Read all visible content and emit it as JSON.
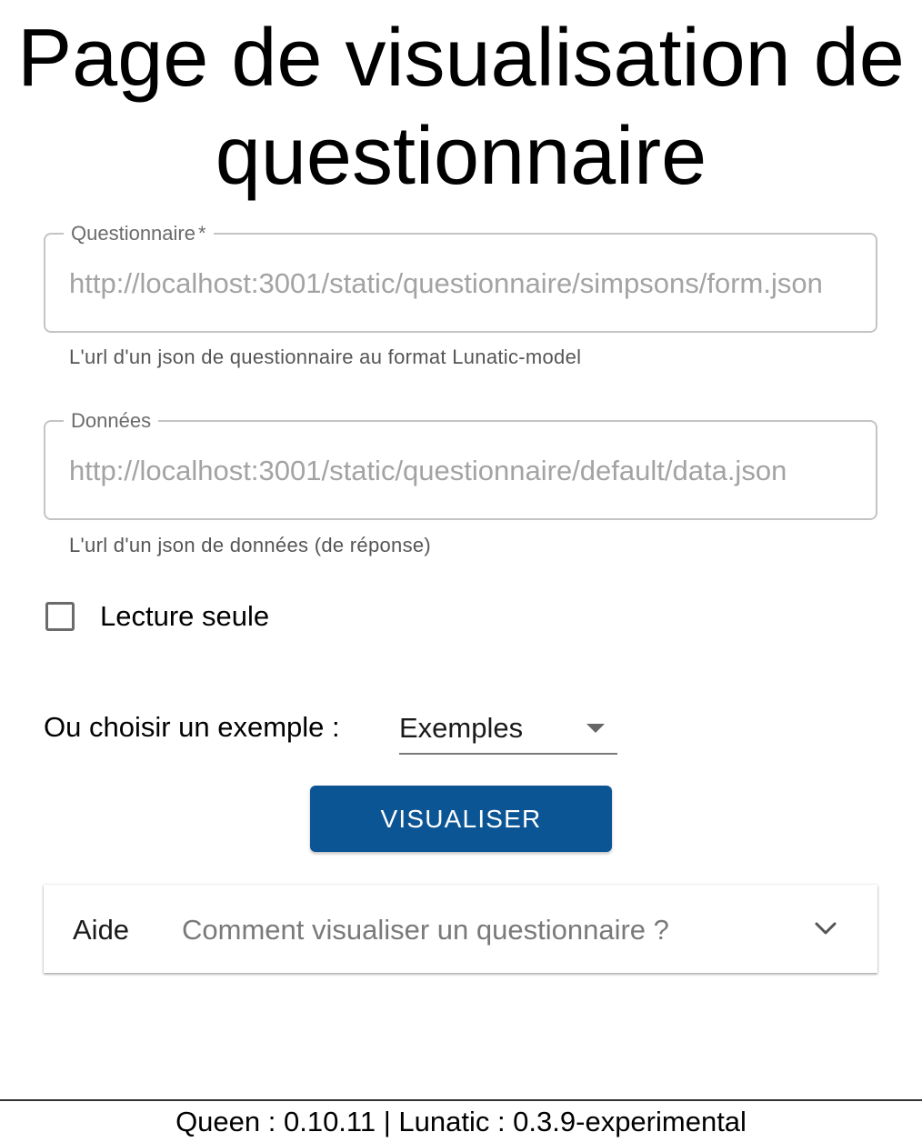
{
  "title": "Page de visualisation de questionnaire",
  "questionnaire_field": {
    "label": "Questionnaire",
    "required_mark": "*",
    "placeholder": "http://localhost:3001/static/questionnaire/simpsons/form.json",
    "helper": "L'url d'un json de questionnaire au format Lunatic-model"
  },
  "data_field": {
    "label": "Données",
    "placeholder": "http://localhost:3001/static/questionnaire/default/data.json",
    "helper": "L'url d'un json de données (de réponse)"
  },
  "readonly_checkbox": {
    "label": "Lecture seule",
    "checked": false
  },
  "examples": {
    "label": "Ou choisir un exemple :",
    "selected": "Exemples"
  },
  "visualize_button": {
    "label": "VISUALISER",
    "color": "#0b5595"
  },
  "help_accordion": {
    "title": "Aide",
    "subtitle": "Comment visualiser un questionnaire ?"
  },
  "footer": {
    "text": "Queen : 0.10.11 | Lunatic : 0.3.9-experimental"
  }
}
